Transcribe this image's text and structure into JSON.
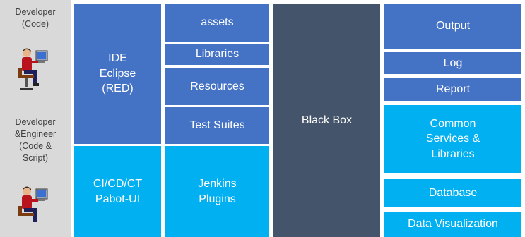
{
  "side": {
    "developer_code": "Developer\n(Code)",
    "developer_engineer": "Developer\n&Engineer\n(Code &\nScript)"
  },
  "blocks": {
    "ide": "IDE\nEclipse\n(RED)",
    "assets": "assets",
    "libraries": "Libraries",
    "resources": "Resources",
    "test_suites": "Test Suites",
    "cicd": "CI/CD/CT\nPabot-UI",
    "jenkins": "Jenkins\nPlugins",
    "black_box": "Black Box",
    "output": "Output",
    "log": "Log",
    "report": "Report",
    "common_services": "Common\nServices &\nLibraries",
    "database": "Database",
    "data_visualization": "Data Visualization"
  },
  "colors": {
    "dark_blue": "#4472c4",
    "light_blue": "#00b0f0",
    "black_box": "#44546a",
    "sidebar": "#d9d9d9"
  },
  "icons": [
    "developer-person-icon",
    "engineer-person-icon"
  ]
}
